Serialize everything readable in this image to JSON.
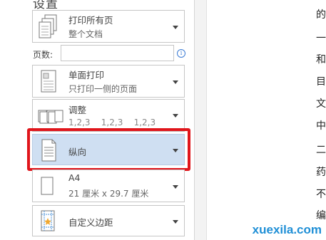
{
  "heading": "设置",
  "options": {
    "print_range": {
      "title": "打印所有页",
      "subtitle": "整个文档"
    },
    "pages_label": "页数:",
    "pages_input_value": "",
    "sides": {
      "title": "单面打印",
      "subtitle": "只打印一侧的页面"
    },
    "collate": {
      "title": "调整",
      "subtitle": "1,2,3    1,2,3    1,2,3"
    },
    "orientation": {
      "title": "纵向"
    },
    "paper": {
      "title": "A4",
      "subtitle": "21 厘米 x 29.7 厘米"
    },
    "margins": {
      "title": "自定义边距"
    }
  },
  "document_chars": [
    "的",
    "一",
    "和",
    "目",
    "文",
    "中",
    "二",
    "药",
    "不",
    "编"
  ],
  "watermark": "xuexila.com",
  "colors": {
    "highlight": "#e0151b",
    "selected_bg": "#cfdff2",
    "watermark": "#1f8fd6"
  }
}
